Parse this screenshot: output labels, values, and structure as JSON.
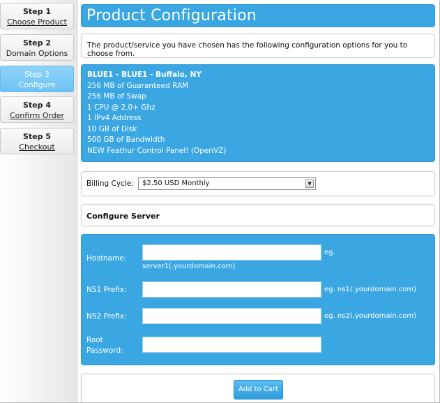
{
  "sidebar": {
    "steps": [
      {
        "number": "Step 1",
        "label": "Choose Product"
      },
      {
        "number": "Step 2",
        "label": "Domain Options"
      },
      {
        "number": "Step 3",
        "label": "Configure"
      },
      {
        "number": "Step 4",
        "label": "Confirm Order"
      },
      {
        "number": "Step 5",
        "label": "Checkout"
      }
    ]
  },
  "page_title": "Product Configuration",
  "intro_text": "The product/service you have chosen has the following configuration options for you to choose from.",
  "product": {
    "name": "BLUE1 - BLUE1 - Buffalo, NY",
    "features": [
      "256 MB of Guaranteed RAM",
      "256 MB of Swap",
      "1 CPU @ 2.0+ Ghz",
      "1 IPv4 Address",
      "10 GB of Disk",
      "500 GB of Bandwidth",
      "NEW Feathur Control Panel! (OpenVZ)"
    ]
  },
  "billing": {
    "label": "Billing Cycle:",
    "selected": "$2.50 USD Monthly"
  },
  "configure_server": {
    "heading": "Configure Server",
    "hostname": {
      "label": "Hostname:",
      "value": "",
      "help_line1": "eg.",
      "help_line2": "server1(.yourdomain.com)"
    },
    "ns1": {
      "label": "NS1 Prefix:",
      "value": "",
      "help": "eg. ns1(.yourdomain.com)"
    },
    "ns2": {
      "label": "NS2 Prefix:",
      "value": "",
      "help": "eg. ns2(.yourdomain.com)"
    },
    "root": {
      "label_line1": "Root",
      "label_line2": "Password:",
      "value": ""
    }
  },
  "cart": {
    "button_label": "Add to Cart"
  },
  "colors": {
    "accent_blue": "#3aa7e3",
    "active_step": "#7ccaf7"
  }
}
